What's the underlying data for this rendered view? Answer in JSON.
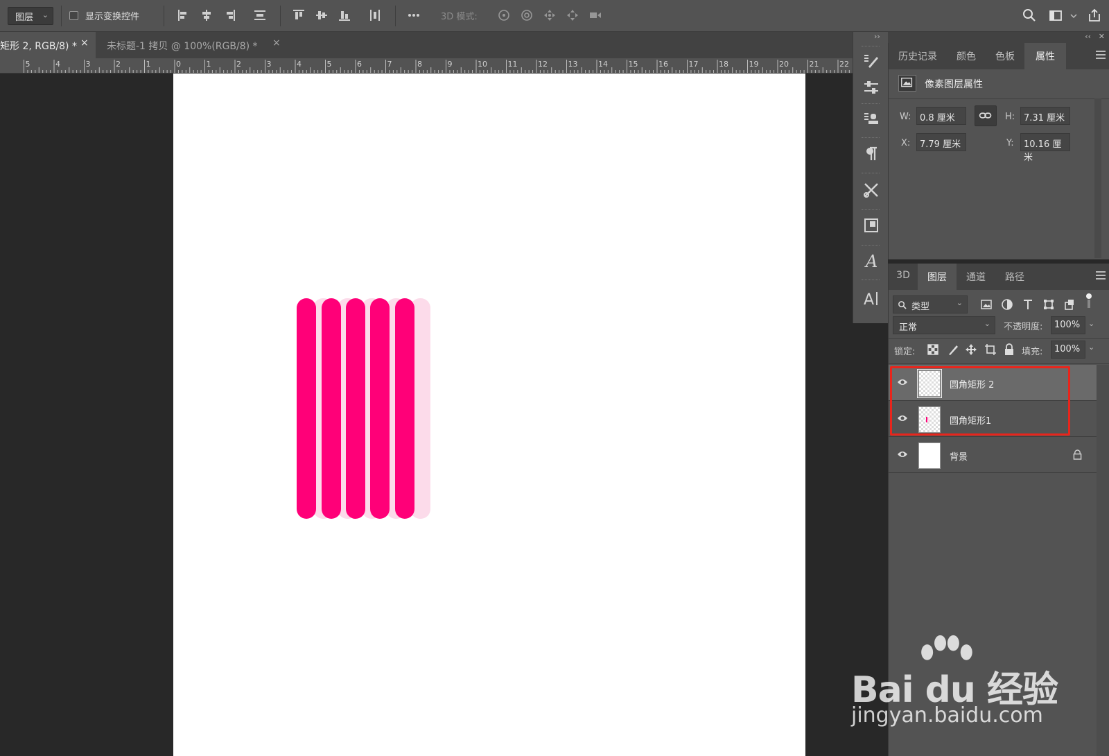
{
  "options_bar": {
    "layer_select": "图层",
    "show_transform_label": "显示变换控件",
    "mode_3d_label": "3D 模式:"
  },
  "tabs": [
    {
      "label": "矩形 2, RGB/8) *",
      "close": "×"
    },
    {
      "label": "未标题-1 拷贝 @ 100%(RGB/8) *",
      "close": "×"
    }
  ],
  "ruler": {
    "labels": [
      "5",
      "4",
      "3",
      "2",
      "1",
      "0",
      "1",
      "2",
      "3",
      "4",
      "5",
      "6",
      "7",
      "8",
      "9",
      "10",
      "11",
      "12",
      "13",
      "14",
      "15",
      "16",
      "17",
      "18",
      "19",
      "20",
      "21",
      "22"
    ]
  },
  "canvas": {
    "stripe_colors": {
      "dark": "#ff0078",
      "light": "#fcdbea"
    }
  },
  "panel_collapse": {
    "left": "››",
    "right": "‹‹",
    "close": "✕"
  },
  "properties_panel": {
    "tabs": [
      "历史记录",
      "颜色",
      "色板",
      "属性"
    ],
    "active_tab": "属性",
    "section_title": "像素图层属性",
    "w_label": "W:",
    "w_value": "0.8 厘米",
    "h_label": "H:",
    "h_value": "7.31 厘米",
    "x_label": "X:",
    "x_value": "7.79 厘米",
    "y_label": "Y:",
    "y_value": "10.16 厘米"
  },
  "layers_panel": {
    "tabs": [
      "3D",
      "图层",
      "通道",
      "路径"
    ],
    "active_tab": "图层",
    "filter_label": "类型",
    "blend_mode": "正常",
    "opacity_label": "不透明度:",
    "opacity_value": "100%",
    "lock_label": "锁定:",
    "fill_label": "填充:",
    "fill_value": "100%",
    "layers": [
      {
        "name": "圆角矩形 2",
        "selected": true
      },
      {
        "name": "圆角矩形1",
        "selected": false
      },
      {
        "name": "背景",
        "selected": false,
        "locked": true
      }
    ]
  },
  "watermark": {
    "brand": "Bai du 经验",
    "url": "jingyan.baidu.com"
  },
  "colors": {
    "highlight": "#e8251c",
    "panel_bg": "#535353",
    "canvas_bg": "#282828"
  }
}
